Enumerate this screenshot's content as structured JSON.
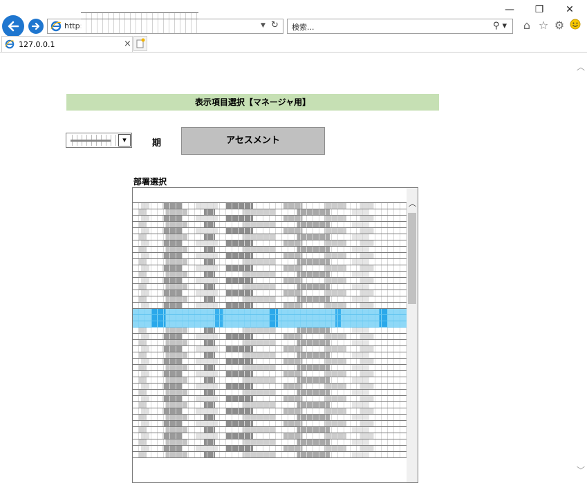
{
  "window": {
    "minimize_glyph": "—",
    "restore_glyph": "❐",
    "close_glyph": "✕"
  },
  "toolbar": {
    "address_url_visible": "http:",
    "search_placeholder": "検索...",
    "tab_title": "127.0.0.1",
    "tab_close_glyph": "×",
    "icons": [
      "back-icon",
      "forward-icon",
      "home-icon",
      "favorites-star-icon",
      "settings-gear-icon",
      "smiley-feedback-icon"
    ]
  },
  "page": {
    "title": "表示項目選択【マネージャ用】",
    "period_label": "期",
    "assessment_button": "アセスメント",
    "department_label": "部署選択"
  },
  "colors": {
    "title_bg": "#c6e0b4",
    "button_bg": "#c0c0c0",
    "selection": "#8ed8f7",
    "ie_blue": "#1f76cf"
  }
}
